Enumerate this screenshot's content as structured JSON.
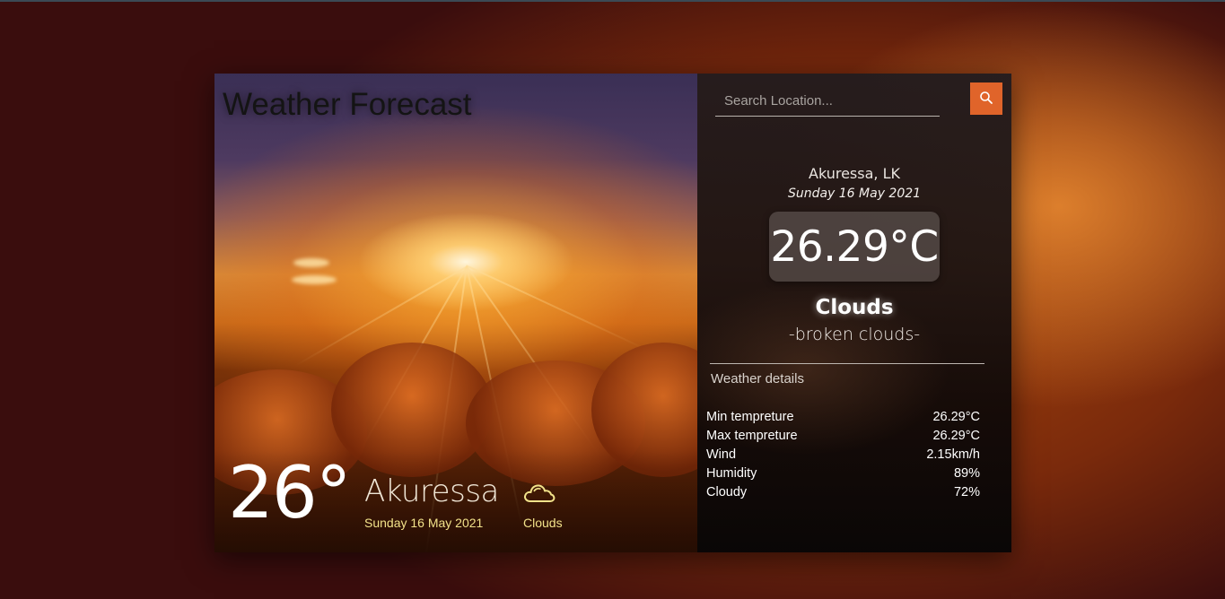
{
  "app": {
    "title": "Weather Forecast"
  },
  "hero": {
    "temperature": "26°",
    "city": "Akuressa",
    "date": "Sunday 16 May 2021",
    "condition_icon": "cloud-icon",
    "condition": "Clouds"
  },
  "search": {
    "placeholder": "Search Location...",
    "value": "",
    "button_icon": "search-icon"
  },
  "current": {
    "location": "Akuressa, LK",
    "date": "Sunday 16 May 2021",
    "temperature": "26.29°C",
    "condition": "Clouds",
    "description": "-broken clouds-"
  },
  "details": {
    "title": "Weather details",
    "rows": [
      {
        "label": "Min tempreture",
        "value": "26.29°C"
      },
      {
        "label": "Max tempreture",
        "value": "26.29°C"
      },
      {
        "label": "Wind",
        "value": "2.15km/h"
      },
      {
        "label": "Humidity",
        "value": "89%"
      },
      {
        "label": "Cloudy",
        "value": "72%"
      }
    ]
  },
  "colors": {
    "accent": "#e0642a",
    "hero_text": "#f2e28a"
  }
}
